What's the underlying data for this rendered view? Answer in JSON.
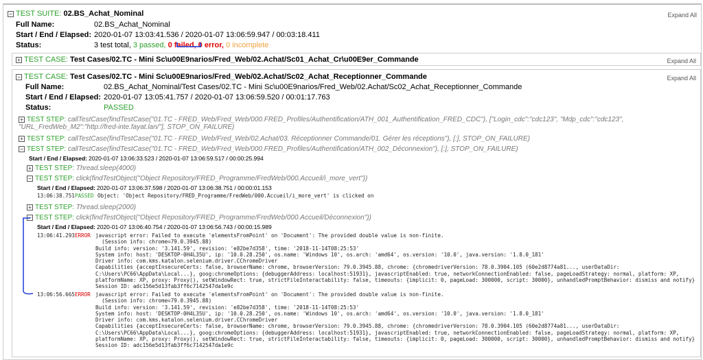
{
  "suite": {
    "kind": "TEST SUITE:",
    "name": "02.BS_Achat_Nominal",
    "expand": "Expand All",
    "labels": {
      "full": "Full Name:",
      "time": "Start / End / Elapsed:",
      "status": "Status:"
    },
    "full_name": "02.BS_Achat_Nominal",
    "time": "2020-01-07 13:03:41.536 / 2020-01-07 13:06:59.947 / 00:03:18.411",
    "status": {
      "total": "3 test total,",
      "passed": " 3 passed,",
      "failed": " 0 failed,",
      "error": " 0 error,",
      "incomplete": " 0 incomplete"
    }
  },
  "tc1": {
    "kind": "TEST CASE:",
    "name": "Test Cases/02.TC - Mini Sc\\u00E9narios/Fred_Web/02.Achat/Sc01_Achat_Cr\\u00E9er_Commande",
    "expand": "Expand All"
  },
  "tc2": {
    "kind": "TEST CASE:",
    "name": "Test Cases/02.TC - Mini Sc\\u00E9narios/Fred_Web/02.Achat/Sc02_Achat_Receptionner_Commande",
    "expand": "Expand All",
    "full_name": "02.BS_Achat_Nominal/Test Cases/02.TC - Mini Sc\\u00E9narios/Fred_Web/02.Achat/Sc02_Achat_Receptionner_Commande",
    "time": "2020-01-07 13:05:41.757 / 2020-01-07 13:06:59.520 / 00:01:17.763",
    "status": "PASSED"
  },
  "step_kind": "TEST STEP:",
  "steps": [
    {
      "desc": "callTestCase(findTestCase(\"01.TC - FRED_Web/Fred_Web/000.FRED_Profiles/Authentification/ATH_001_Authentification_FRED_CDC\"), [\"Login_cdc\":\"cdc123\", \"Mdp_cdc\":\"cdc123\", \"URL_FredWeb_M2\":\"http://fred-inte.fayat.lan/\"], STOP_ON_FAILURE)"
    },
    {
      "desc": "callTestCase(findTestCase(\"01.TC - FRED_Web/Fred_Web/02.Achat/03. Réceptionner Commande/01. Gérer les réceptions\"), [:], STOP_ON_FAILURE)"
    },
    {
      "desc": "callTestCase(findTestCase(\"01.TC - FRED_Web/Fred_Web/000.FRED_Profiles/Authentification/ATH_002_Déconnexion\"), [:], STOP_ON_FAILURE)",
      "time": "2020-01-07 13:06:33.523 / 2020-01-07 13:06:59.517 / 00:00:25.994"
    },
    {
      "desc": "Thread.sleep(4000)"
    },
    {
      "desc": "click(findTestObject(\"Object Repository/FRED_Programme/FredWeb/000.Accueil/i_more_vert\"))",
      "time": "2020-01-07 13:06:37.598 / 2020-01-07 13:06:38.751 / 00:00:01.153",
      "log": {
        "ts": "13:06:38.751",
        "level": "PASSED",
        "msg": "Object: 'Object Repository/FRED_Programme/FredWeb/000.Accueil/i_more_vert' is clicked on"
      }
    },
    {
      "desc": "Thread.sleep(2000)"
    },
    {
      "desc": "click(findTestObject(\"Object Repository/FRED_Programme/FredWeb/000.Accueil/Déconnexion\"))",
      "time": "2020-01-07 13:06:40.754 / 2020-01-07 13:06:56.743 / 00:00:15.989"
    }
  ],
  "errors": [
    {
      "ts": "13:06:41.293",
      "level": "ERROR",
      "msg": "javascript error: Failed to execute 'elementsFromPoint' on 'Document': The provided double value is non-finite.\n  (Session info: chrome=79.0.3945.88)\nBuild info: version: '3.141.59', revision: 'e82be7d358', time: '2018-11-14T08:25:53'\nSystem info: host: 'DESKTOP-0H4L35U', ip: '10.0.28.250', os.name: 'Windows 10', os.arch: 'amd64', os.version: '10.0', java.version: '1.8.0_181'\nDriver info: com.kms.katalon.selenium.driver.CChromeDriver\nCapabilities {acceptInsecureCerts: false, browserName: chrome, browserVersion: 79.0.3945.88, chrome: {chromedriverVersion: 78.0.3904.105 (60e2d8774a81..., userDataDir:\nC:\\Users\\PC66\\AppData\\Local...}, goog:chromeOptions: {debuggerAddress: localhost:51931}, javascriptEnabled: true, networkConnectionEnabled: false, pageLoadStrategy: normal, platform: XP,\nplatformName: XP, proxy: Proxy(), setWindowRect: true, strictFileInteractability: false, timeouts: {implicit: 0, pageLoad: 300000, script: 30000}, unhandledPromptBehavior: dismiss and notify}\nSession ID: adc156e5d13fab3ff6c7142547da1e9c"
    },
    {
      "ts": "13:06:56.665",
      "level": "ERROR",
      "msg": "javascript error: Failed to execute 'elementsFromPoint' on 'Document': The provided double value is non-finite.\n  (Session info: chrome=79.0.3945.88)\nBuild info: version: '3.141.59', revision: 'e82be7d358', time: '2018-11-14T08:25:53'\nSystem info: host: 'DESKTOP-0H4L35U', ip: '10.0.28.250', os.name: 'Windows 10', os.arch: 'amd64', os.version: '10.0', java.version: '1.8.0_181'\nDriver info: com.kms.katalon.selenium.driver.CChromeDriver\nCapabilities {acceptInsecureCerts: false, browserName: chrome, browserVersion: 79.0.3945.88, chrome: {chromedriverVersion: 78.0.3904.105 (60e2d8774a81..., userDataDir:\nC:\\Users\\PC66\\AppData\\Local...}, goog:chromeOptions: {debuggerAddress: localhost:51931}, javascriptEnabled: true, networkConnectionEnabled: false, pageLoadStrategy: normal, platform: XP,\nplatformName: XP, proxy: Proxy(), setWindowRect: true, strictFileInteractability: false, timeouts: {implicit: 0, pageLoad: 300000, script: 30000}, unhandledPromptBehavior: dismiss and notify}\nSession ID: adc156e5d13fab3ff6c7142547da1e9c"
    }
  ]
}
